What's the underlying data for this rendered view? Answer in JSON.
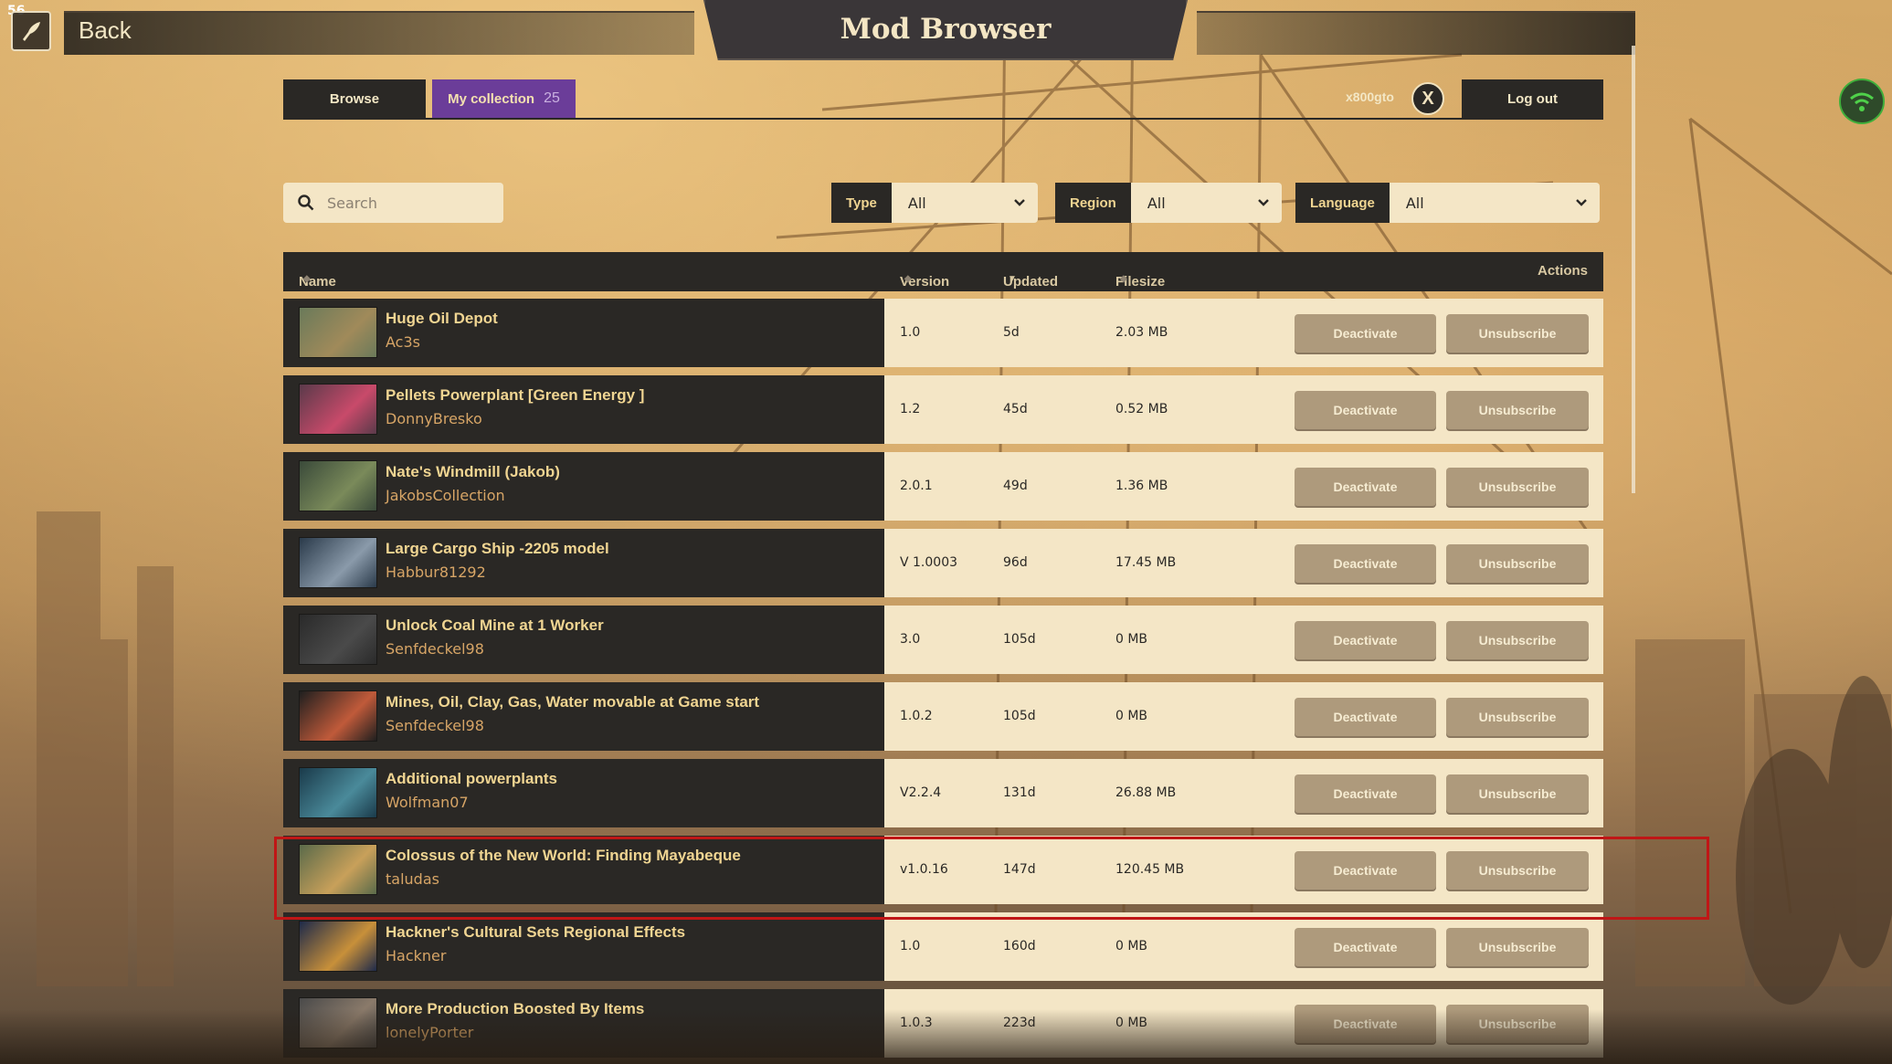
{
  "hud": {
    "fps": "56"
  },
  "header": {
    "back_label": "Back",
    "title": "Mod Browser"
  },
  "tabs": {
    "browse": "Browse",
    "collection": "My collection",
    "collection_count": "25"
  },
  "account": {
    "username": "x800gto",
    "x_label": "X",
    "logout": "Log out"
  },
  "search": {
    "placeholder": "Search"
  },
  "filters": [
    {
      "label": "Type",
      "value": "All"
    },
    {
      "label": "Region",
      "value": "All"
    },
    {
      "label": "Language",
      "value": "All"
    }
  ],
  "columns": {
    "name": "Name",
    "version": "Version",
    "updated": "Updated",
    "filesize": "Filesize",
    "actions": "Actions"
  },
  "actions": {
    "deactivate": "Deactivate",
    "unsubscribe": "Unsubscribe"
  },
  "colors": {
    "accent_purple": "#6b3d99",
    "panel_dark": "#2a2825",
    "panel_light": "#f4e6c6",
    "title_gold": "#f0d592",
    "author_orange": "#d7a566",
    "highlight_red": "#c01616"
  },
  "mods": [
    {
      "name": "Huge Oil Depot",
      "author": "Ac3s",
      "version": "1.0",
      "updated": "5d",
      "filesize": "2.03 MB"
    },
    {
      "name": "Pellets Powerplant [Green Energy ]",
      "author": "DonnyBresko",
      "version": "1.2",
      "updated": "45d",
      "filesize": "0.52 MB"
    },
    {
      "name": "Nate's Windmill (Jakob)",
      "author": "JakobsCollection",
      "version": "2.0.1",
      "updated": "49d",
      "filesize": "1.36 MB"
    },
    {
      "name": "Large Cargo Ship -2205 model",
      "author": "Habbur81292",
      "version": "V 1.0003",
      "updated": "96d",
      "filesize": "17.45 MB"
    },
    {
      "name": "Unlock Coal Mine at 1 Worker",
      "author": "Senfdeckel98",
      "version": "3.0",
      "updated": "105d",
      "filesize": "0 MB"
    },
    {
      "name": "Mines, Oil, Clay, Gas, Water movable at Game start",
      "author": "Senfdeckel98",
      "version": "1.0.2",
      "updated": "105d",
      "filesize": "0 MB"
    },
    {
      "name": "Additional powerplants",
      "author": "Wolfman07",
      "version": "V2.2.4",
      "updated": "131d",
      "filesize": "26.88 MB"
    },
    {
      "name": "Colossus of the New World: Finding Mayabeque",
      "author": "taludas",
      "version": "v1.0.16",
      "updated": "147d",
      "filesize": "120.45 MB"
    },
    {
      "name": "Hackner's Cultural Sets Regional Effects",
      "author": "Hackner",
      "version": "1.0",
      "updated": "160d",
      "filesize": "0 MB"
    },
    {
      "name": "More Production Boosted By Items",
      "author": "lonelyPorter",
      "version": "1.0.3",
      "updated": "223d",
      "filesize": "0 MB"
    }
  ]
}
